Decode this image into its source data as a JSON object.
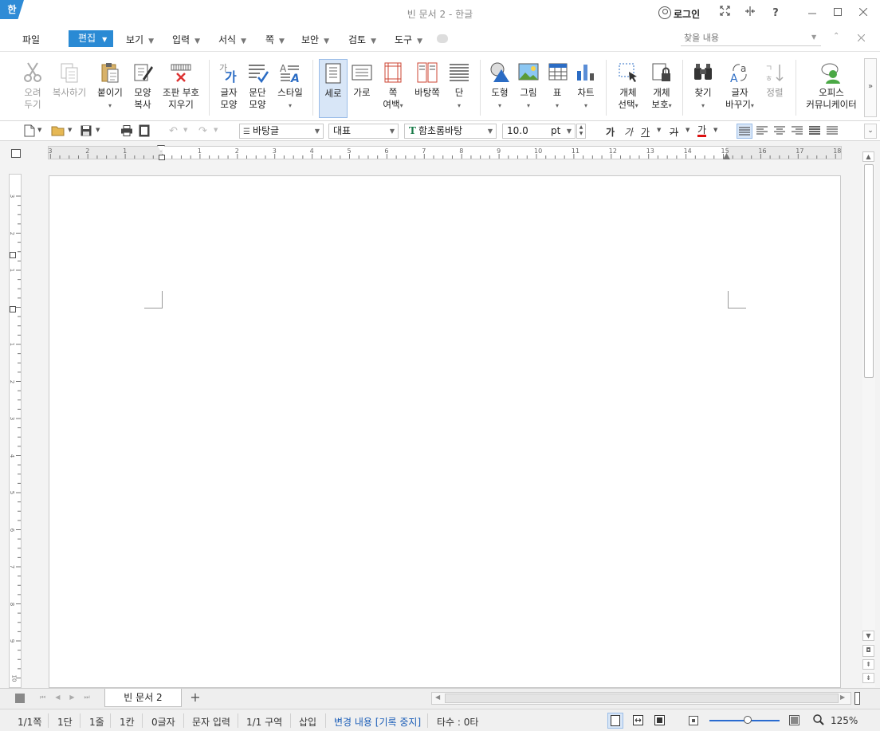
{
  "window": {
    "app_icon": "한",
    "title": "빈 문서 2 - 한글",
    "login_label": "로그인",
    "buttons": [
      "fullscreen-icon",
      "split-icon",
      "help-icon",
      "minimize-icon",
      "maximize-icon",
      "close-icon"
    ],
    "help_label": "?"
  },
  "menubar": {
    "file": "파일",
    "items": [
      "편집",
      "보기",
      "입력",
      "서식",
      "쪽",
      "보안",
      "검토",
      "도구"
    ],
    "search_placeholder": "찾을 내용"
  },
  "ribbon": {
    "cut": [
      "오려",
      "두기"
    ],
    "copy": "복사하기",
    "paste": "붙이기",
    "format_copy": [
      "모양",
      "복사"
    ],
    "erase": [
      "조판 부호",
      "지우기"
    ],
    "char_shape": [
      "글자",
      "모양"
    ],
    "para_shape": [
      "문단",
      "모양"
    ],
    "style": "스타일",
    "vertical": "세로",
    "horizontal": "가로",
    "page_margin": [
      "쪽",
      "여백"
    ],
    "background": "바탕쪽",
    "column": "단",
    "shape": "도형",
    "picture": "그림",
    "table": "표",
    "chart": "차트",
    "obj_select": [
      "개체",
      "선택"
    ],
    "obj_protect": [
      "개체",
      "보호"
    ],
    "find": "찾기",
    "replace": [
      "글자",
      "바꾸기"
    ],
    "sort": "정렬",
    "office": [
      "오피스",
      "커뮤니케이터"
    ]
  },
  "toolbar": {
    "style_value": "바탕글",
    "lang_value": "대표",
    "font_value": "함초롬바탕",
    "size_value": "10.0",
    "size_unit": "pt",
    "bold": "가",
    "italic": "가",
    "underline": "가",
    "strike": "가",
    "color": "가"
  },
  "ruler": {
    "h_numbers": [
      "3",
      "2",
      "1",
      "",
      "1",
      "2",
      "3",
      "4",
      "5",
      "6",
      "7",
      "8",
      "9",
      "10",
      "11",
      "12",
      "13",
      "14",
      "15",
      "16",
      "17",
      "18"
    ],
    "v_numbers": [
      "3",
      "2",
      "1",
      "",
      "1",
      "2",
      "3",
      "4",
      "5",
      "6",
      "7",
      "8",
      "9",
      "10"
    ]
  },
  "tabs": {
    "doc_tab": "빈 문서 2",
    "add": "+"
  },
  "status": {
    "page": "1/1쪽",
    "column": "1단",
    "line": "1줄",
    "col": "1칸",
    "chars": "0글자",
    "input_mode": "문자 입력",
    "section": "1/1 구역",
    "insert": "삽입",
    "track": "변경 내용 [기록 중지]",
    "typing": "타수 : 0타",
    "zoom": "125%",
    "zoom_level": 0.55
  }
}
